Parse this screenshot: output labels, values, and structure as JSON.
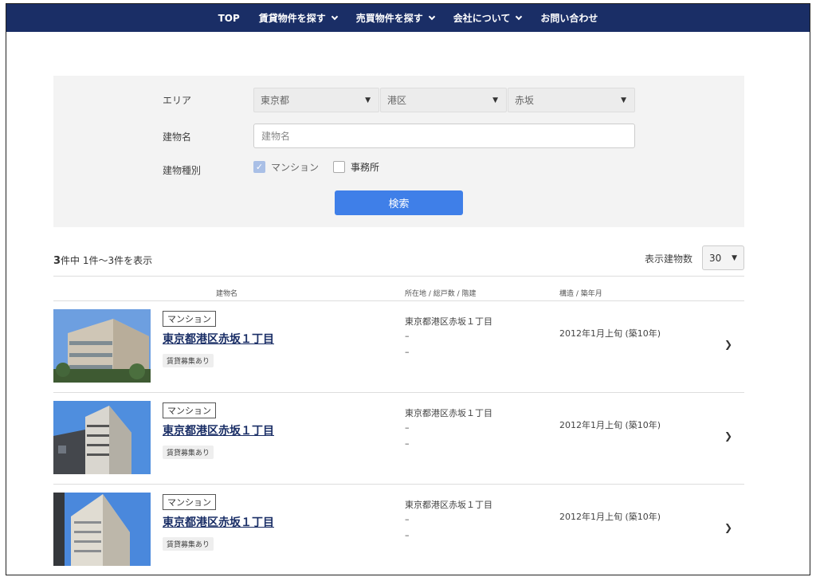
{
  "nav": {
    "items": [
      {
        "label": "TOP",
        "dropdown": false
      },
      {
        "label": "賃貸物件を探す",
        "dropdown": true
      },
      {
        "label": "売買物件を探す",
        "dropdown": true
      },
      {
        "label": "会社について",
        "dropdown": true
      },
      {
        "label": "お問い合わせ",
        "dropdown": false
      }
    ]
  },
  "search": {
    "area_label": "エリア",
    "area_prefecture": "東京都",
    "area_ward": "港区",
    "area_town": "赤坂",
    "building_name_label": "建物名",
    "building_name_placeholder": "建物名",
    "building_type_label": "建物種別",
    "type_mansion": "マンション",
    "type_office": "事務所",
    "type_mansion_checked": true,
    "type_office_checked": false,
    "submit_label": "検索"
  },
  "results": {
    "count": "3",
    "count_suffix": "件中 1件〜3件を表示",
    "per_page_label": "表示建物数",
    "per_page_value": "30",
    "col_name": "建物名",
    "col_address": "所在地 / 総戸数 / 階建",
    "col_structure": "構造 / 築年月",
    "items": [
      {
        "type": "マンション",
        "name": "東京都港区赤坂１丁目",
        "badge": "賃貸募集あり",
        "address": "東京都港区赤坂１丁目",
        "units": "–",
        "floors": "–",
        "built": "2012年1月上旬 (築10年)"
      },
      {
        "type": "マンション",
        "name": "東京都港区赤坂１丁目",
        "badge": "賃貸募集あり",
        "address": "東京都港区赤坂１丁目",
        "units": "–",
        "floors": "–",
        "built": "2012年1月上旬 (築10年)"
      },
      {
        "type": "マンション",
        "name": "東京都港区赤坂１丁目",
        "badge": "賃貸募集あり",
        "address": "東京都港区赤坂１丁目",
        "units": "–",
        "floors": "–",
        "built": "2012年1月上旬 (築10年)"
      }
    ]
  },
  "colors": {
    "nav_bg": "#1a2e66",
    "accent": "#3f7fe8",
    "link": "#1a2e66"
  }
}
